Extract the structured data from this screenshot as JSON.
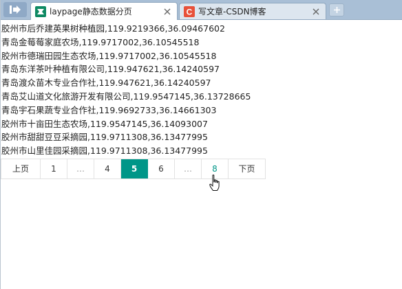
{
  "browser": {
    "tabs": [
      {
        "title": "laypage静态数据分页",
        "active": true,
        "favicon": "layui-favicon-icon"
      },
      {
        "title": "写文章-CSDN博客",
        "active": false,
        "favicon": "csdn-favicon-icon"
      }
    ],
    "new_tab_symbol": "+"
  },
  "records": [
    "胶州市后乔建英果树种植园,119.9219366,36.09467602",
    "青岛金莓莓家庭农场,119.9717002,36.10545518",
    "胶州市德瑞田园生态农场,119.9717002,36.10545518",
    "青岛东洋茶叶种植有限公司,119.947621,36.14240597",
    "青岛渡众苗木专业合作社,119.947621,36.14240597",
    "青岛艾山道文化旅游开发有限公司,119.9547145,36.13728665",
    "青岛宇石果蔬专业合作社,119.9692733,36.14661303",
    "胶州市十亩田生态农场,119.9547145,36.14093007",
    "胶州市甜甜豆豆采摘园,119.9711308,36.13477995",
    "胶州市山里佳园采摘园,119.9711308,36.13477995"
  ],
  "pagination": {
    "prev_label": "上页",
    "next_label": "下页",
    "items": [
      {
        "label": "1",
        "kind": "num"
      },
      {
        "label": "…",
        "kind": "ellipsis"
      },
      {
        "label": "4",
        "kind": "num"
      },
      {
        "label": "5",
        "kind": "current"
      },
      {
        "label": "6",
        "kind": "num"
      },
      {
        "label": "…",
        "kind": "ellipsis"
      },
      {
        "label": "8",
        "kind": "hovered"
      }
    ],
    "current_page": 5,
    "accent_color": "#009688"
  }
}
